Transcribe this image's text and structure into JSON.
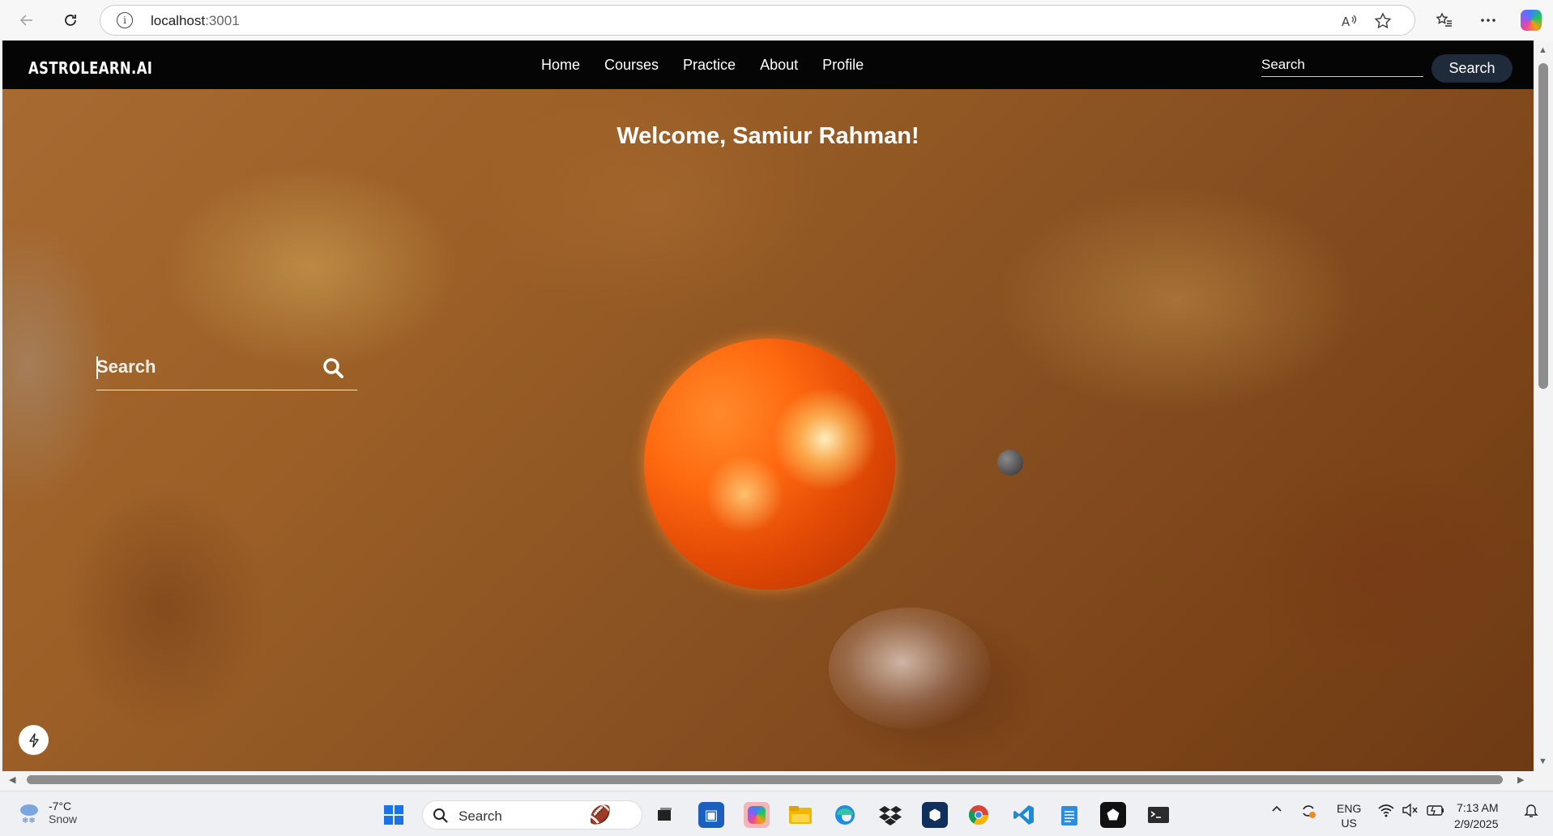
{
  "browser": {
    "url_host": "localhost",
    "url_port": ":3001"
  },
  "navbar": {
    "logo": "ASTROLEARN.AI",
    "links": [
      "Home",
      "Courses",
      "Practice",
      "About",
      "Profile"
    ],
    "search_placeholder": "Search",
    "search_button": "Search"
  },
  "hero": {
    "welcome": "Welcome, Samiur Rahman!",
    "search_placeholder": "Search"
  },
  "taskbar": {
    "weather_temp": "-7°C",
    "weather_condition": "Snow",
    "search_label": "Search",
    "lang_top": "ENG",
    "lang_bottom": "US",
    "time": "7:13 AM",
    "date": "2/9/2025"
  },
  "colors": {
    "navbar_bg": "#050505",
    "search_button_bg": "#1f2a3a",
    "sun": "#ff6a10"
  }
}
